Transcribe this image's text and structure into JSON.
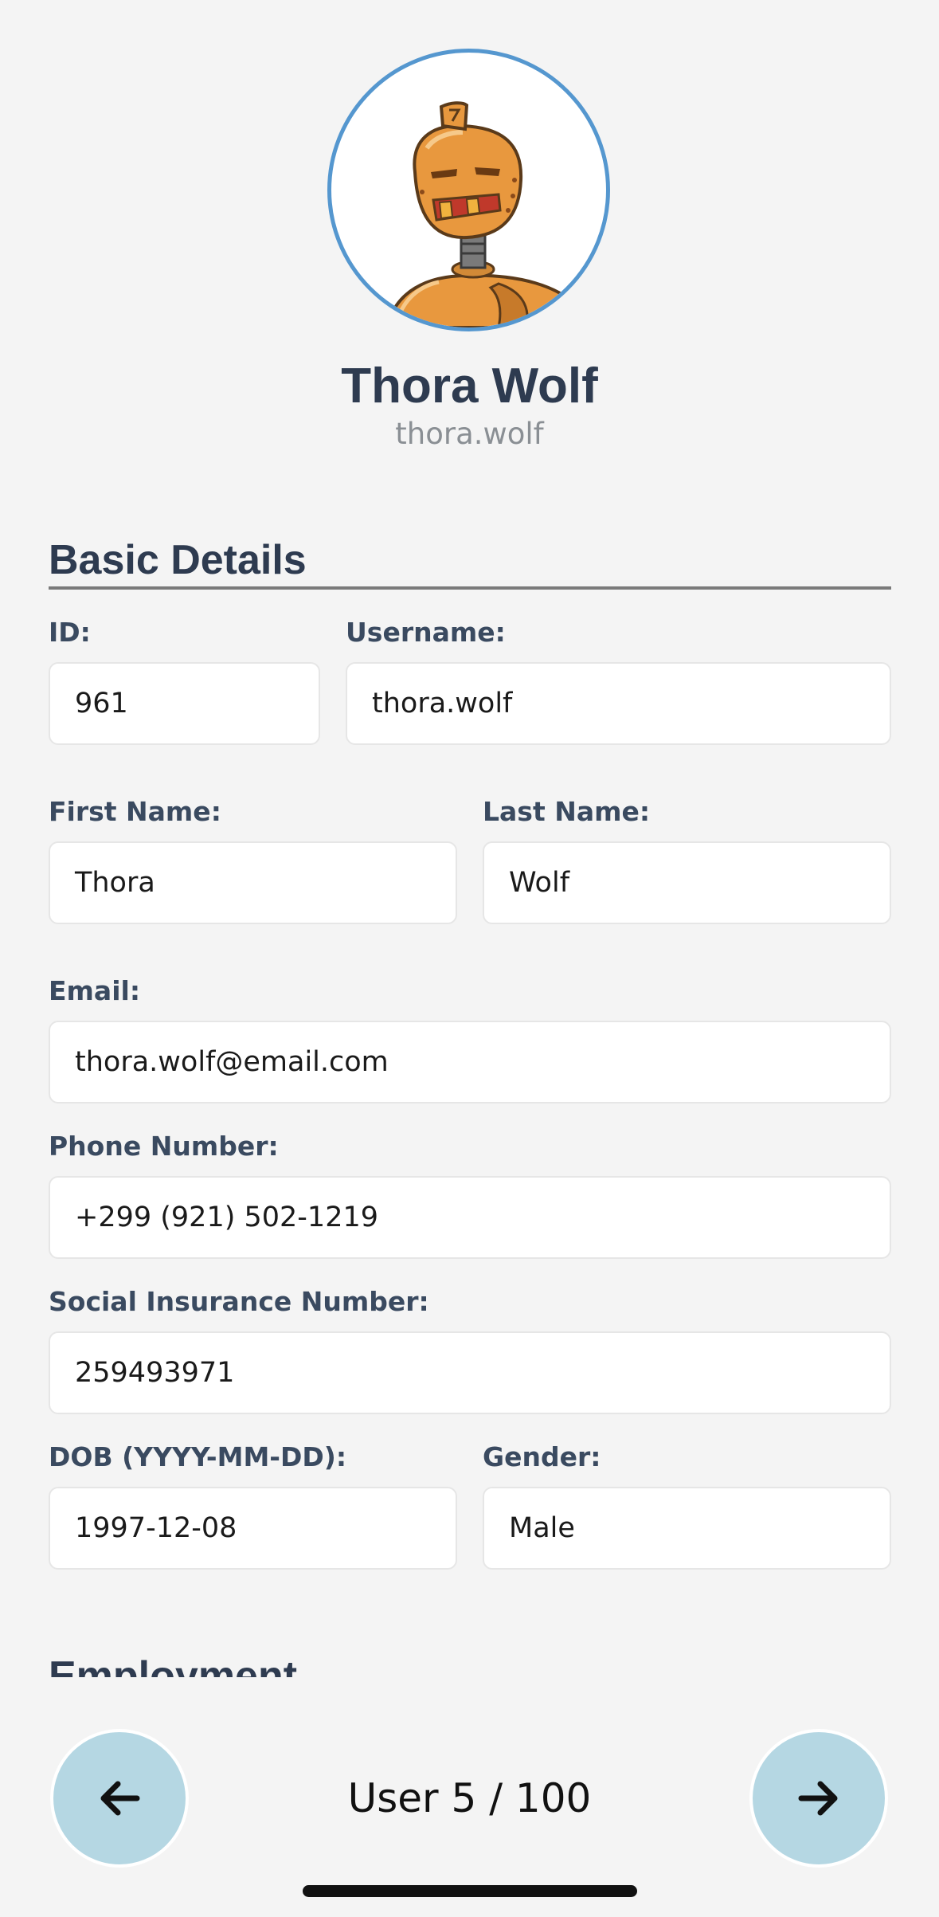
{
  "profile": {
    "full_name": "Thora Wolf",
    "username": "thora.wolf"
  },
  "sections": {
    "basic_details": "Basic Details",
    "employment": "Employment"
  },
  "fields": {
    "id": {
      "label": "ID:",
      "value": "961"
    },
    "username": {
      "label": "Username:",
      "value": "thora.wolf"
    },
    "first_name": {
      "label": "First Name:",
      "value": "Thora"
    },
    "last_name": {
      "label": "Last Name:",
      "value": "Wolf"
    },
    "email": {
      "label": "Email:",
      "value": "thora.wolf@email.com"
    },
    "phone": {
      "label": "Phone Number:",
      "value": "+299 (921) 502-1219"
    },
    "sin": {
      "label": "Social Insurance Number:",
      "value": "259493971"
    },
    "dob": {
      "label": "DOB (YYYY-MM-DD):",
      "value": "1997-12-08"
    },
    "gender": {
      "label": "Gender:",
      "value": "Male"
    }
  },
  "pager": {
    "text": "User 5 / 100"
  },
  "icons": {
    "prev": "arrow-left-icon",
    "next": "arrow-right-icon",
    "avatar": "robot-avatar"
  },
  "colors": {
    "accent": "#5597cf",
    "nav_button": "#b5d7e3",
    "heading": "#2e3b50"
  }
}
